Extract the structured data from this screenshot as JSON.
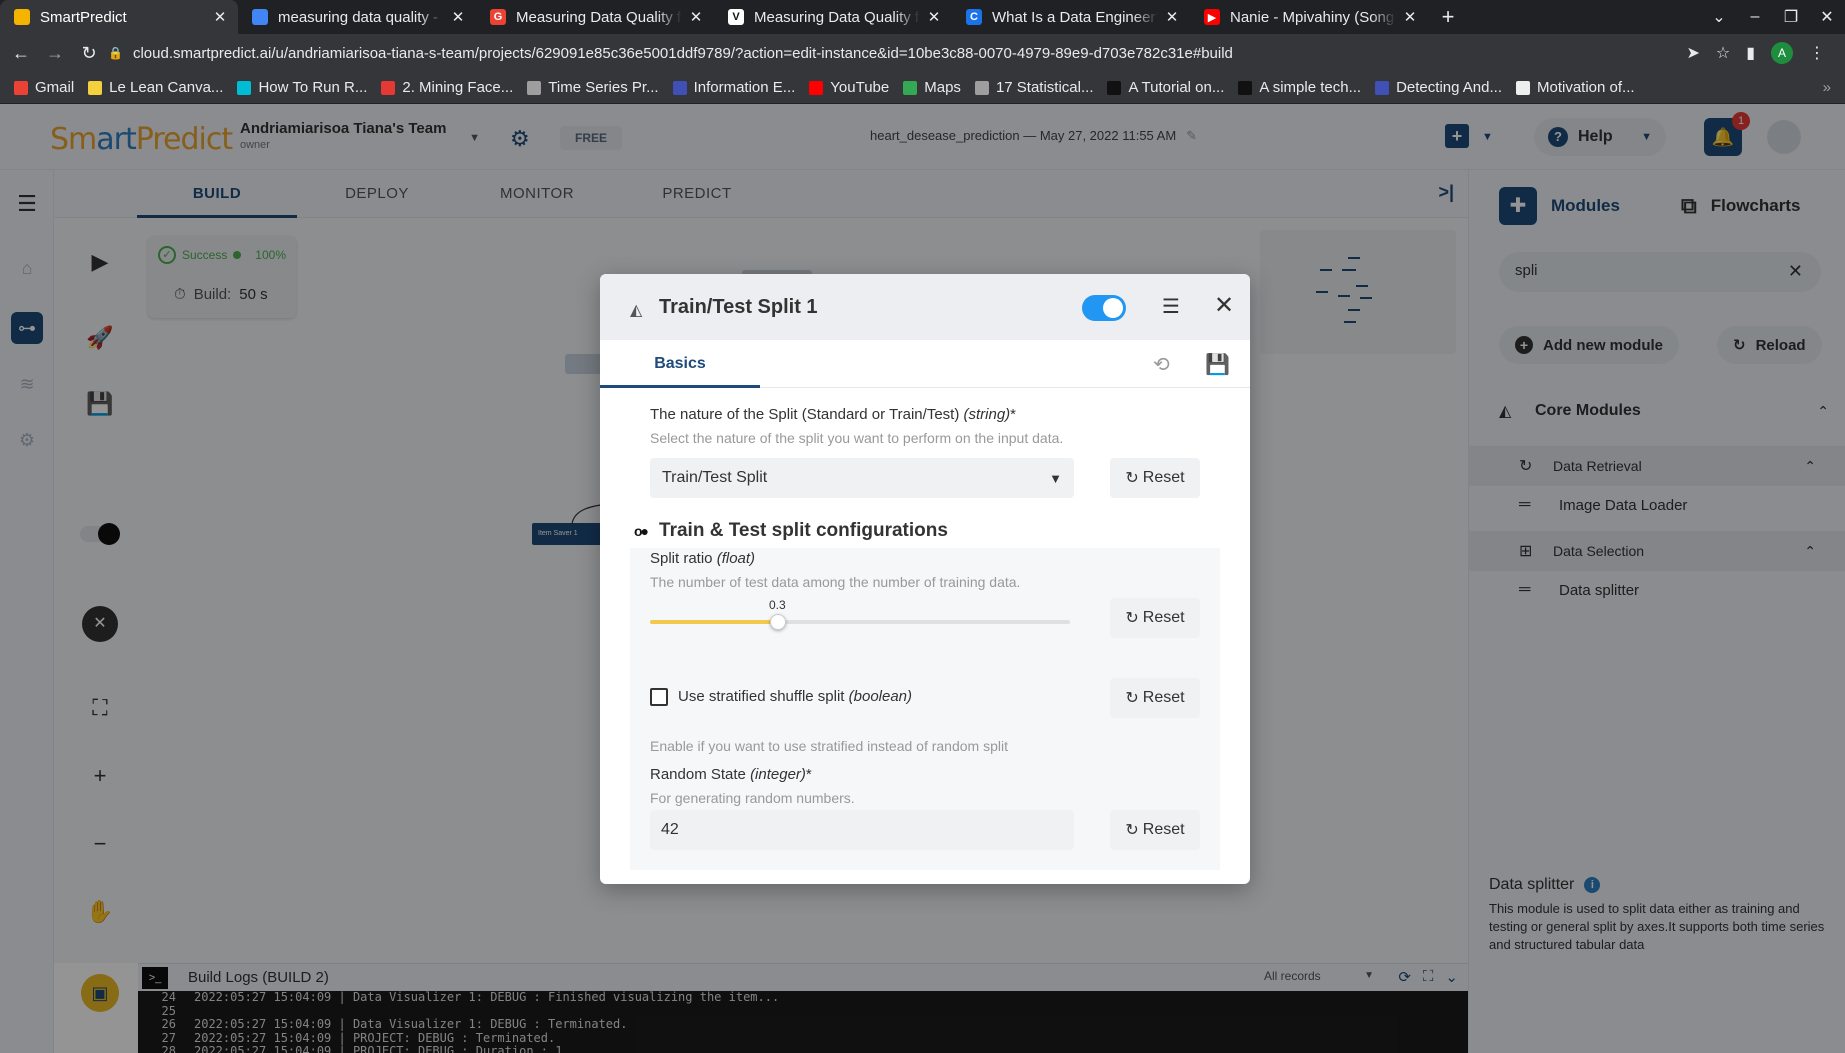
{
  "browser": {
    "tabs": [
      {
        "title": "SmartPredict",
        "color": "#f4b400",
        "glyph": ""
      },
      {
        "title": "measuring data quality - G",
        "color": "#4285f4",
        "glyph": ""
      },
      {
        "title": "Measuring Data Quality fo",
        "color": "#ea4335",
        "glyph": "G"
      },
      {
        "title": "Measuring Data Quality fo",
        "color": "#ffffff",
        "glyph": "V"
      },
      {
        "title": "What Is a Data Engineer?:",
        "color": "#1a73e8",
        "glyph": "C"
      },
      {
        "title": "Nanie - Mpivahiny (Song C",
        "color": "#ff0000",
        "glyph": "▶"
      }
    ],
    "url": "cloud.smartpredict.ai/u/andriamiarisoa-tiana-s-team/projects/629091e85c36e5001ddf9789/?action=edit-instance&id=10be3c88-0070-4979-89e9-d703e782c31e#build",
    "profile_initial": "A",
    "bookmarks": [
      {
        "label": "Gmail",
        "color": "#ea4335"
      },
      {
        "label": "Le Lean Canva...",
        "color": "#f4d03f"
      },
      {
        "label": "How To Run R...",
        "color": "#00bcd4"
      },
      {
        "label": "2. Mining Face...",
        "color": "#e53935"
      },
      {
        "label": "Time Series Pr...",
        "color": "#9e9e9e"
      },
      {
        "label": "Information E...",
        "color": "#3f51b5"
      },
      {
        "label": "YouTube",
        "color": "#ff0000"
      },
      {
        "label": "Maps",
        "color": "#34a853"
      },
      {
        "label": "17 Statistical...",
        "color": "#9e9e9e"
      },
      {
        "label": "A Tutorial on...",
        "color": "#111111"
      },
      {
        "label": "A simple tech...",
        "color": "#111111"
      },
      {
        "label": "Detecting And...",
        "color": "#3f51b5"
      },
      {
        "label": "Motivation of...",
        "color": "#eeeeee"
      }
    ]
  },
  "header": {
    "logo_part1": "Sm",
    "logo_part2": "art",
    "logo_part3": "Predict",
    "team_name": "Andriamiarisoa Tiana's Team",
    "team_role": "owner",
    "plan": "FREE",
    "project": "heart_desease_prediction — May 27, 2022 11:55 AM",
    "help_label": "Help",
    "notifications": "1"
  },
  "build_tabs": [
    "BUILD",
    "DEPLOY",
    "MONITOR",
    "PREDICT"
  ],
  "status": {
    "state": "Success",
    "percent": "100%",
    "build_label": "Build:",
    "build_time": "50 s"
  },
  "canvas": {
    "node_saver": "Item Saver 1"
  },
  "logs": {
    "title": "Build Logs (BUILD 2)",
    "filter": "All records",
    "lines": [
      {
        "n": "24",
        "text": "2022:05:27 15:04:09 | Data Visualizer 1: DEBUG : Finished visualizing the item..."
      },
      {
        "n": "25",
        "text": ""
      },
      {
        "n": "26",
        "text": "2022:05:27 15:04:09 | Data Visualizer 1: DEBUG : Terminated."
      },
      {
        "n": "27",
        "text": "2022:05:27 15:04:09 | PROJECT: DEBUG : Terminated."
      },
      {
        "n": "28",
        "text": "2022:05:27 15:04:09 | PROJECT: DEBUG : Duration : 1"
      }
    ]
  },
  "right_panel": {
    "tab_modules": "Modules",
    "tab_flowcharts": "Flowcharts",
    "search_value": "spli",
    "add_module": "Add new module",
    "reload": "Reload",
    "core_modules": "Core Modules",
    "data_retrieval": "Data Retrieval",
    "image_data_loader": "Image Data Loader",
    "data_selection": "Data Selection",
    "data_splitter": "Data splitter",
    "desc_title": "Data splitter",
    "desc_text": "This module is used to split data either as training and testing or general split by axes.It supports both time series and structured tabular data"
  },
  "modal": {
    "title": "Train/Test Split 1",
    "enabled": true,
    "tab_basics": "Basics",
    "nature_label": "The nature of the Split (Standard or Train/Test)",
    "nature_type": "(string)",
    "nature_req": "*",
    "nature_hint": "Select the nature of the split you want to perform on the input data.",
    "nature_value": "Train/Test Split",
    "reset": "Reset",
    "section_title": "Train & Test split configurations",
    "ratio_label": "Split ratio",
    "ratio_type": "(float)",
    "ratio_hint": "The number of test data among the number of training data.",
    "ratio_value": "0.3",
    "stratified_label": "Use stratified shuffle split",
    "stratified_type": "(boolean)",
    "stratified_checked": false,
    "stratified_hint": "Enable if you want to use stratified instead of random split",
    "random_label": "Random State",
    "random_type": "(integer)",
    "random_req": "*",
    "random_hint": "For generating random numbers.",
    "random_value": "42"
  }
}
